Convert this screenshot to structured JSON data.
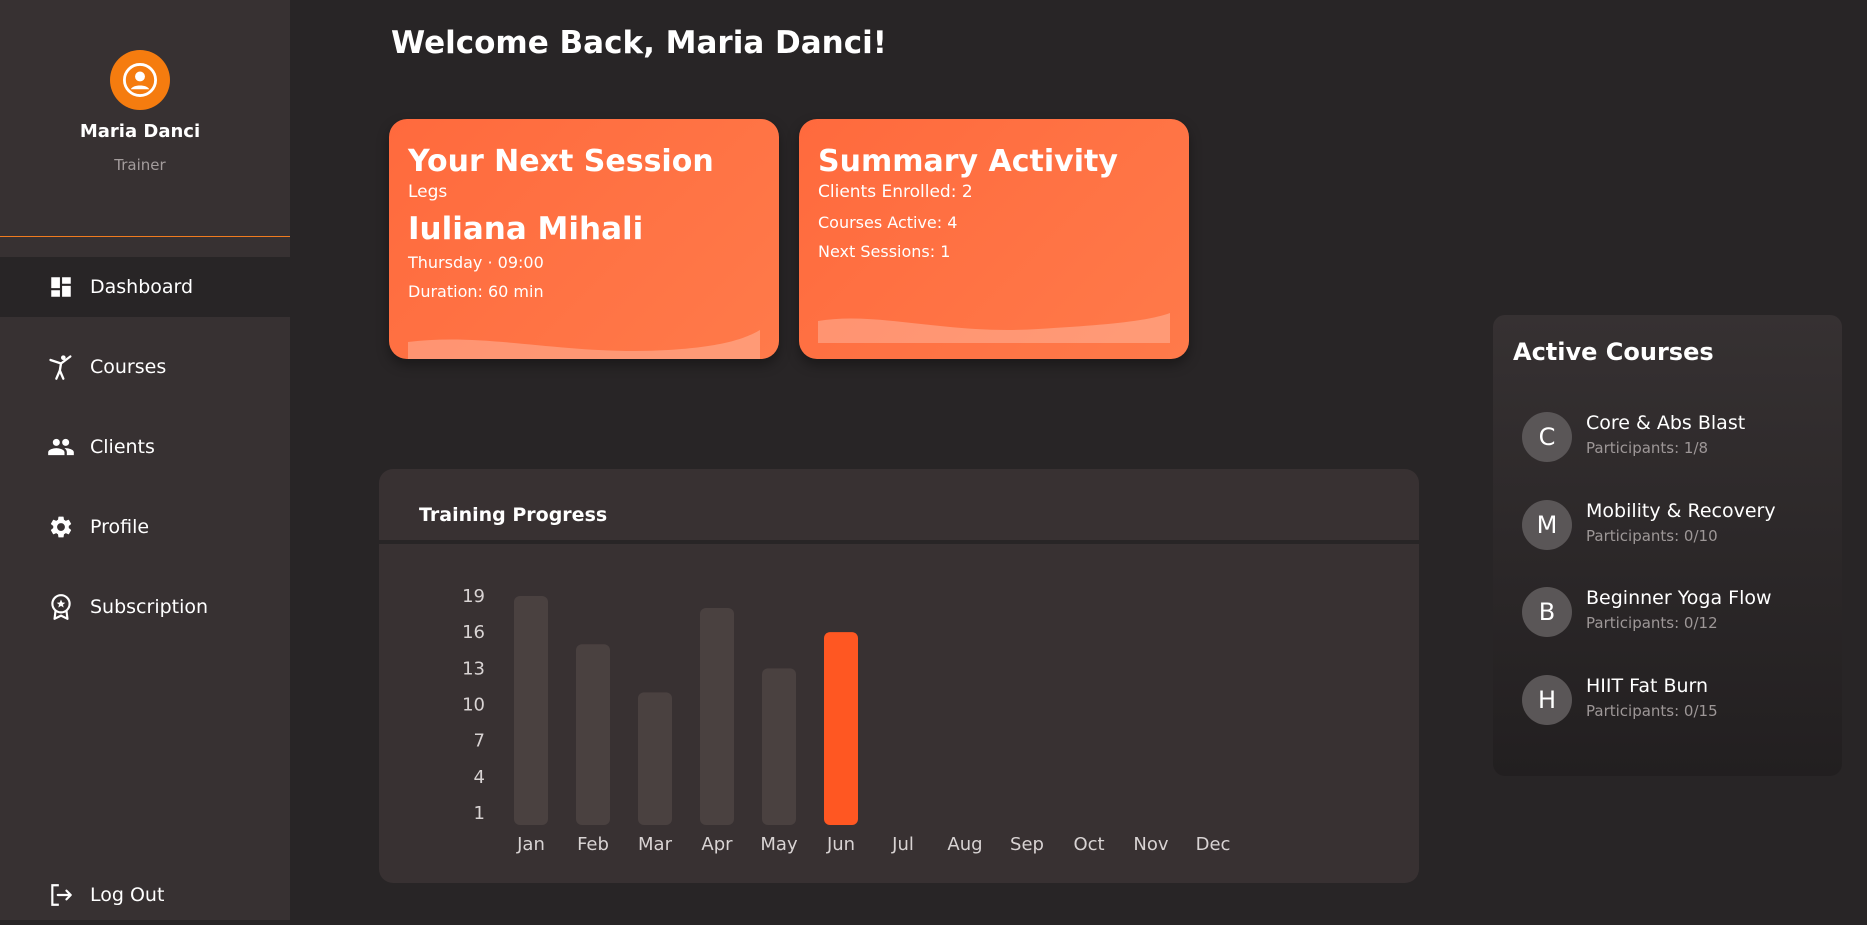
{
  "profile": {
    "name": "Maria Danci",
    "role": "Trainer"
  },
  "nav": {
    "items": [
      {
        "label": "Dashboard",
        "icon": "dashboard-icon",
        "active": true
      },
      {
        "label": "Courses",
        "icon": "martial-arts-icon",
        "active": false
      },
      {
        "label": "Clients",
        "icon": "people-icon",
        "active": false
      },
      {
        "label": "Profile",
        "icon": "gear-icon",
        "active": false
      },
      {
        "label": "Subscription",
        "icon": "badge-icon",
        "active": false
      }
    ],
    "logout": "Log Out"
  },
  "welcome": "Welcome Back, Maria Danci!",
  "next_session": {
    "title": "Your Next Session",
    "type": "Legs",
    "client": "Iuliana Mihali",
    "when": "Thursday · 09:00",
    "duration": "Duration: 60 min"
  },
  "summary": {
    "title": "Summary Activity",
    "clients": "Clients Enrolled: 2",
    "courses": "Courses Active: 4",
    "sessions": "Next Sessions: 1"
  },
  "chart_data": {
    "type": "bar",
    "title": "Training Progress",
    "categories": [
      "Jan",
      "Feb",
      "Mar",
      "Apr",
      "May",
      "Jun",
      "Jul",
      "Aug",
      "Sep",
      "Oct",
      "Nov",
      "Dec"
    ],
    "values": [
      19,
      15,
      11,
      18,
      13,
      16,
      null,
      null,
      null,
      null,
      null,
      null
    ],
    "yticks": [
      1,
      4,
      7,
      10,
      13,
      16,
      19
    ],
    "ylim": [
      0,
      19
    ],
    "highlight_index": 5,
    "colors": {
      "bar": "#4a4140",
      "highlight": "#ff5722"
    }
  },
  "active_courses": {
    "title": "Active Courses",
    "items": [
      {
        "initial": "C",
        "name": "Core & Abs Blast",
        "participants": "Participants: 1/8"
      },
      {
        "initial": "M",
        "name": "Mobility & Recovery",
        "participants": "Participants: 0/10"
      },
      {
        "initial": "B",
        "name": "Beginner Yoga Flow",
        "participants": "Participants: 0/12"
      },
      {
        "initial": "H",
        "name": "HIIT Fat Burn",
        "participants": "Participants: 0/15"
      }
    ]
  },
  "colors": {
    "accent": "#ff6a3d",
    "sidebar": "#373132",
    "background": "#282526"
  }
}
